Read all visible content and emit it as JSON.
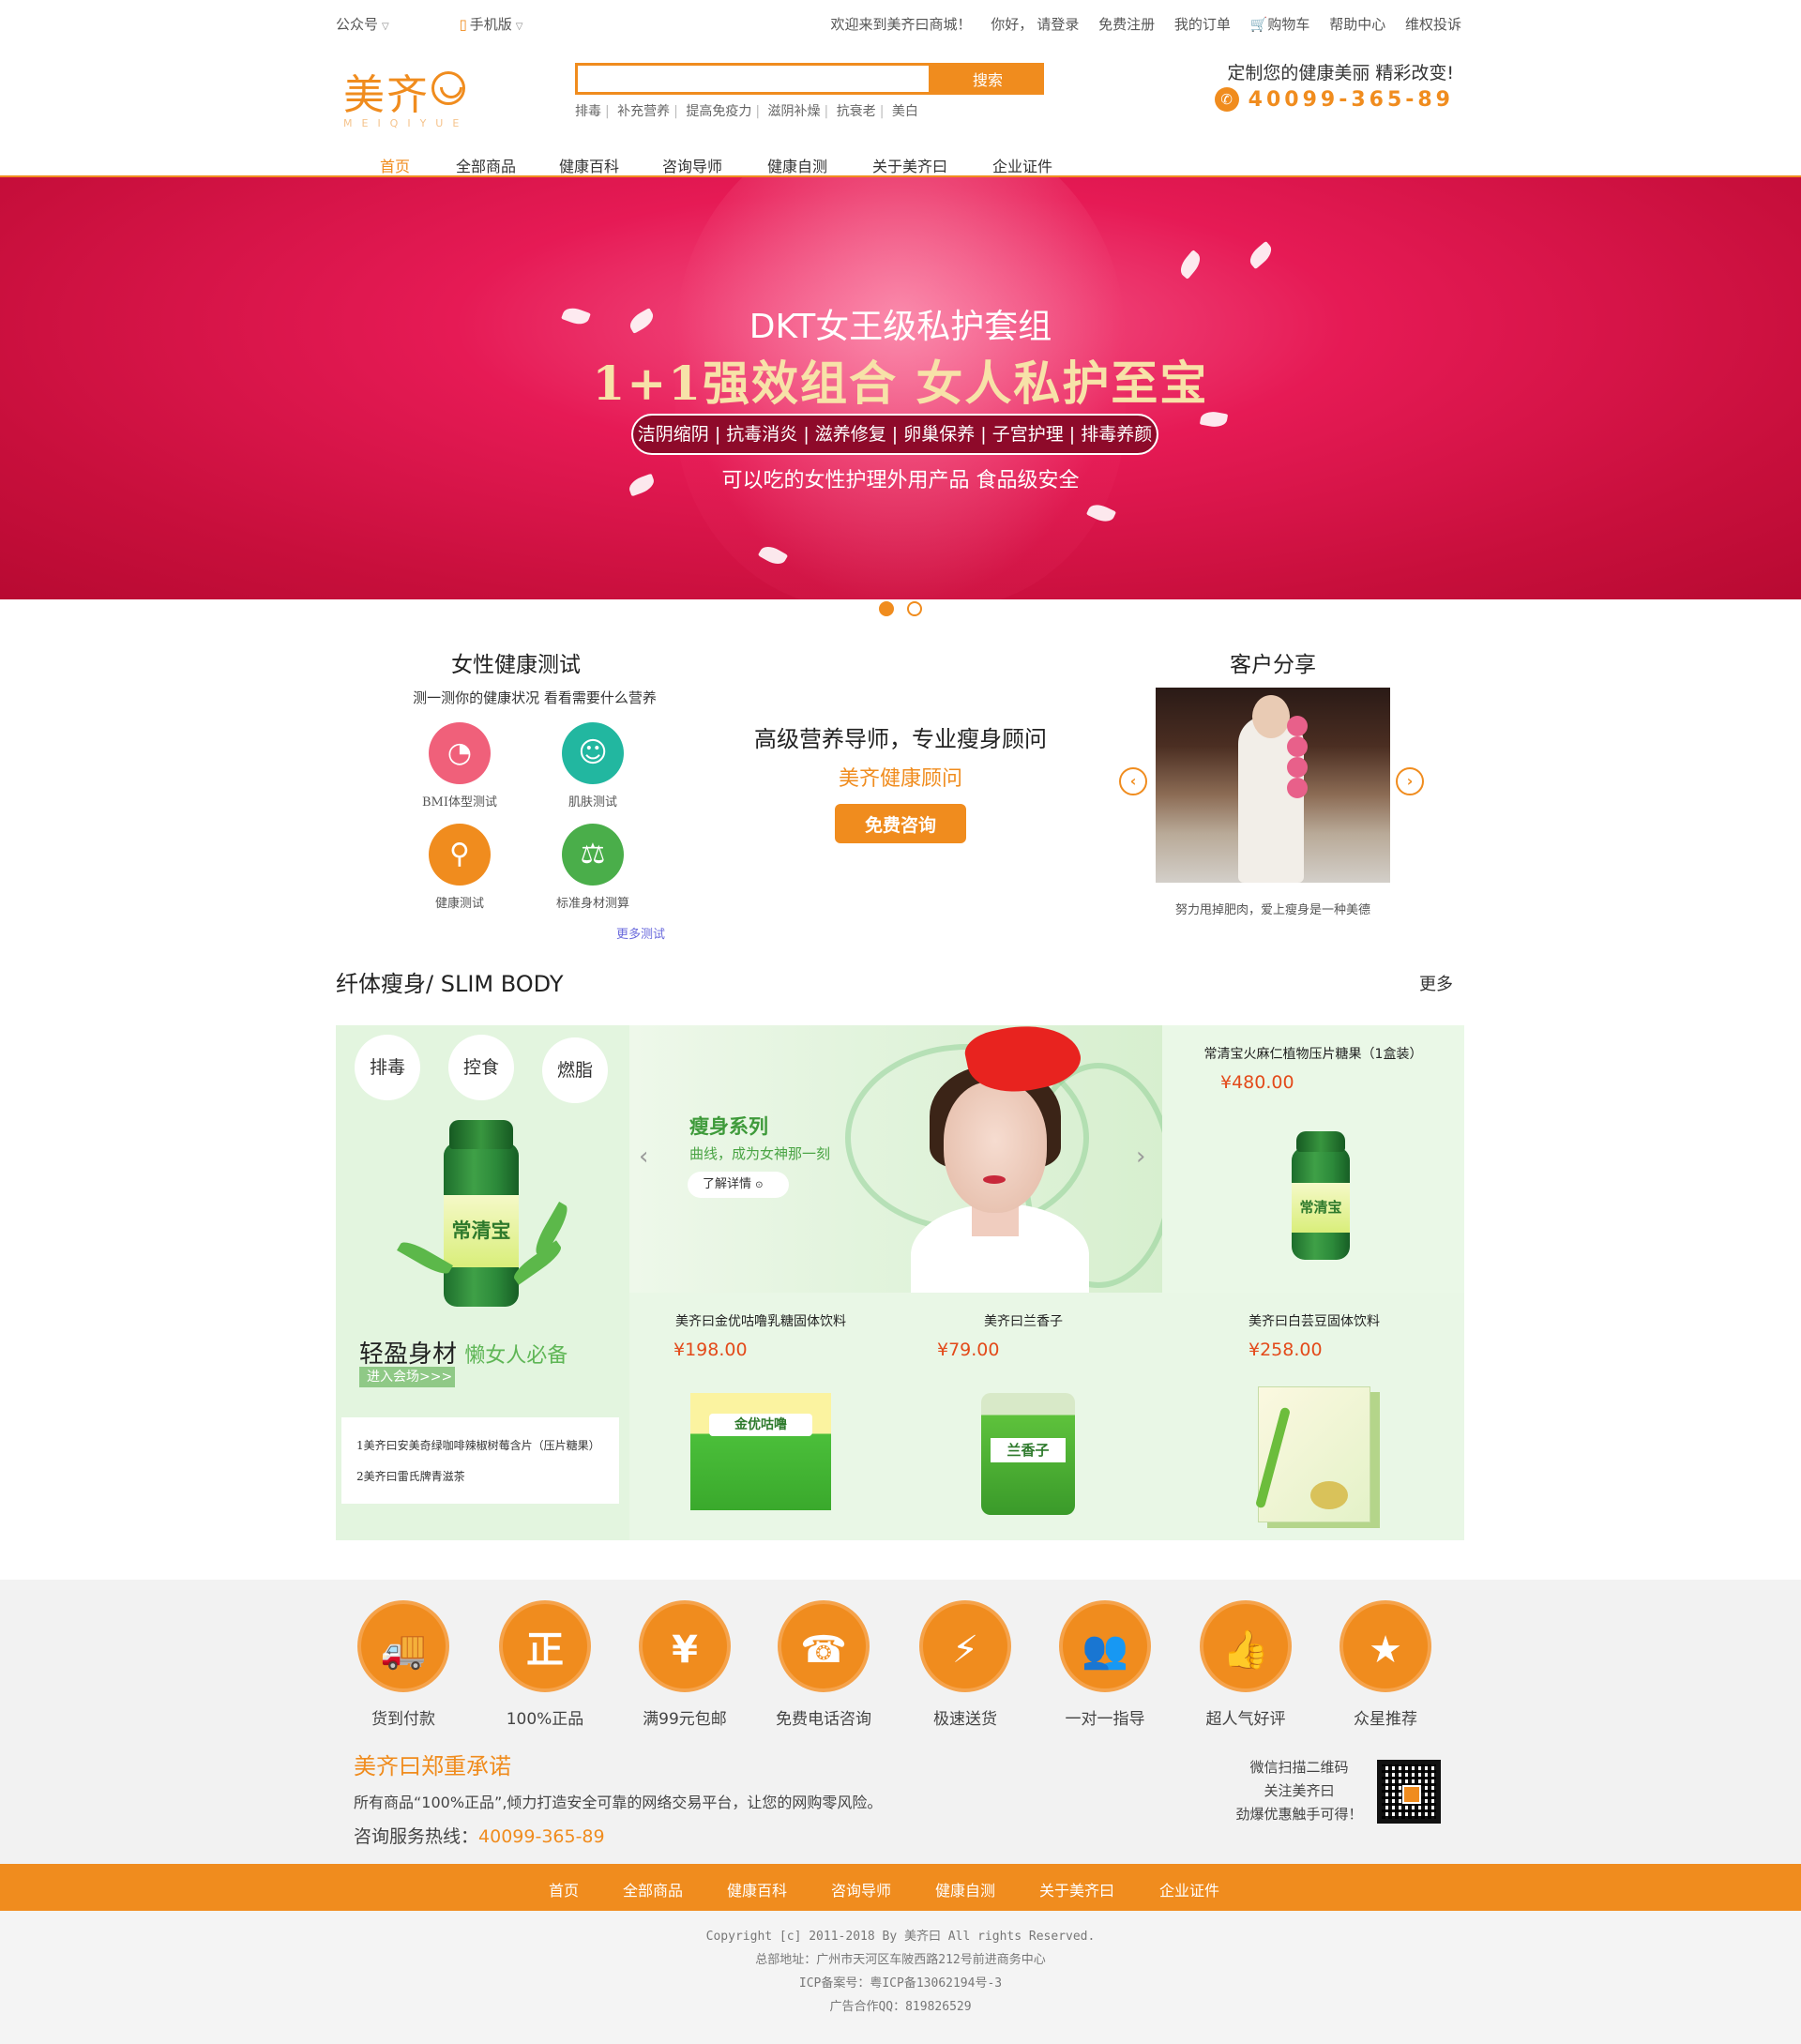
{
  "topbar": {
    "wechat": "公众号",
    "mobile": "手机版",
    "welcome": "欢迎来到美齐曰商城！",
    "hello": "你好，",
    "login": "请登录",
    "register": "免费注册",
    "orders": "我的订单",
    "cart": "购物车",
    "help": "帮助中心",
    "complaint": "维权投诉"
  },
  "header": {
    "logo_cn": "美齐",
    "logo_en": "MEIQIYUE",
    "search_button": "搜索",
    "search_value": "",
    "hot_keywords": [
      "排毒",
      "补充营养",
      "提高免疫力",
      "滋阴补燥",
      "抗衰老",
      "美白"
    ],
    "slogan": "定制您的健康美丽 精彩改变!",
    "hotline": "40099-365-89"
  },
  "nav": [
    "首页",
    "全部商品",
    "健康百科",
    "咨询导师",
    "健康自测",
    "关于美齐曰",
    "企业证件"
  ],
  "banner": {
    "title": "DKT女王级私护套组",
    "headline": "1+1强效组合 女人私护至宝",
    "features": "洁阴缩阴 | 抗毒消炎 | 滋养修复 | 卵巢保养 | 子宫护理 | 排毒养颜",
    "subline": "可以吃的女性护理外用产品 食品级安全",
    "slides": 2,
    "active_slide": 1
  },
  "health_test": {
    "title": "女性健康测试",
    "subtitle": "测一测你的健康状况 看看需要什么营养",
    "items": [
      {
        "label": "BMI体型测试",
        "icon": "scale-icon",
        "color": "#f0607a"
      },
      {
        "label": "肌肤测试",
        "icon": "face-icon",
        "color": "#22b7a0"
      },
      {
        "label": "健康测试",
        "icon": "body-icon",
        "color": "#f08c1e"
      },
      {
        "label": "标准身材测算",
        "icon": "weight-icon",
        "color": "#4aae4a"
      }
    ],
    "more": "更多测试"
  },
  "consult": {
    "title": "高级营养导师，专业瘦身顾问",
    "subtitle": "美齐健康顾问",
    "button": "免费咨询"
  },
  "share": {
    "title": "客户分享",
    "caption": "努力甩掉肥肉，爱上瘦身是一种美德"
  },
  "slim": {
    "title": "纤体瘦身/ SLIM BODY",
    "more": "更多",
    "tags": [
      "排毒",
      "控食",
      "燃脂"
    ],
    "bottle_brand": "常清宝",
    "left_caption": "轻盈身材",
    "left_caption_accent": "懒女人必备",
    "enter": "进入会场>>>",
    "list": [
      "1美齐曰安美奇绿咖啡辣椒树莓含片（压片糖果）",
      "2美齐曰雷氏牌青滋茶"
    ],
    "banner": {
      "title": "瘦身系列",
      "subtitle": "曲线，成为女神那一刻",
      "button": "了解详情"
    },
    "products": [
      {
        "name": "常清宝火麻仁植物压片糖果（1盒装）",
        "price": "¥480.00"
      },
      {
        "name": "美齐曰金优咕噜乳糖固体饮料",
        "price": "¥198.00",
        "box_text": "金优咕噜"
      },
      {
        "name": "美齐曰兰香子",
        "price": "¥79.00",
        "box_text": "兰香子"
      },
      {
        "name": "美齐曰白芸豆固体饮料",
        "price": "¥258.00"
      }
    ]
  },
  "services": [
    {
      "label": "货到付款",
      "icon": "truck-icon",
      "glyph": "🚚"
    },
    {
      "label": "100%正品",
      "icon": "shield-icon",
      "glyph": "正"
    },
    {
      "label": "满99元包邮",
      "icon": "moneybag-icon",
      "glyph": "¥"
    },
    {
      "label": "免费电话咨询",
      "icon": "phone-icon",
      "glyph": "☎"
    },
    {
      "label": "极速送货",
      "icon": "lightning-icon",
      "glyph": "⚡"
    },
    {
      "label": "一对一指导",
      "icon": "people-icon",
      "glyph": "👥"
    },
    {
      "label": "超人气好评",
      "icon": "thumbs-up-icon",
      "glyph": "👍"
    },
    {
      "label": "众星推荐",
      "icon": "star-badge-icon",
      "glyph": "★"
    }
  ],
  "promise": {
    "title": "美齐曰郑重承诺",
    "desc": "所有商品“100%正品”,倾力打造安全可靠的网络交易平台，让您的网购零风险。",
    "hotline_label": "咨询服务热线：",
    "hotline": "40099-365-89",
    "qr_lines": [
      "微信扫描二维码",
      "关注美齐曰",
      "劲爆优惠触手可得！"
    ]
  },
  "footer": {
    "nav": [
      "首页",
      "全部商品",
      "健康百科",
      "咨询导师",
      "健康自测",
      "关于美齐曰",
      "企业证件"
    ],
    "copyright": "Copyright [c] 2011-2018 By 美齐曰 All rights Reserved.",
    "address": "总部地址：广州市天河区车陂西路212号前进商务中心",
    "icp": "ICP备案号：粤ICP备13062194号-3",
    "qq": "广告合作QQ：819826529"
  }
}
